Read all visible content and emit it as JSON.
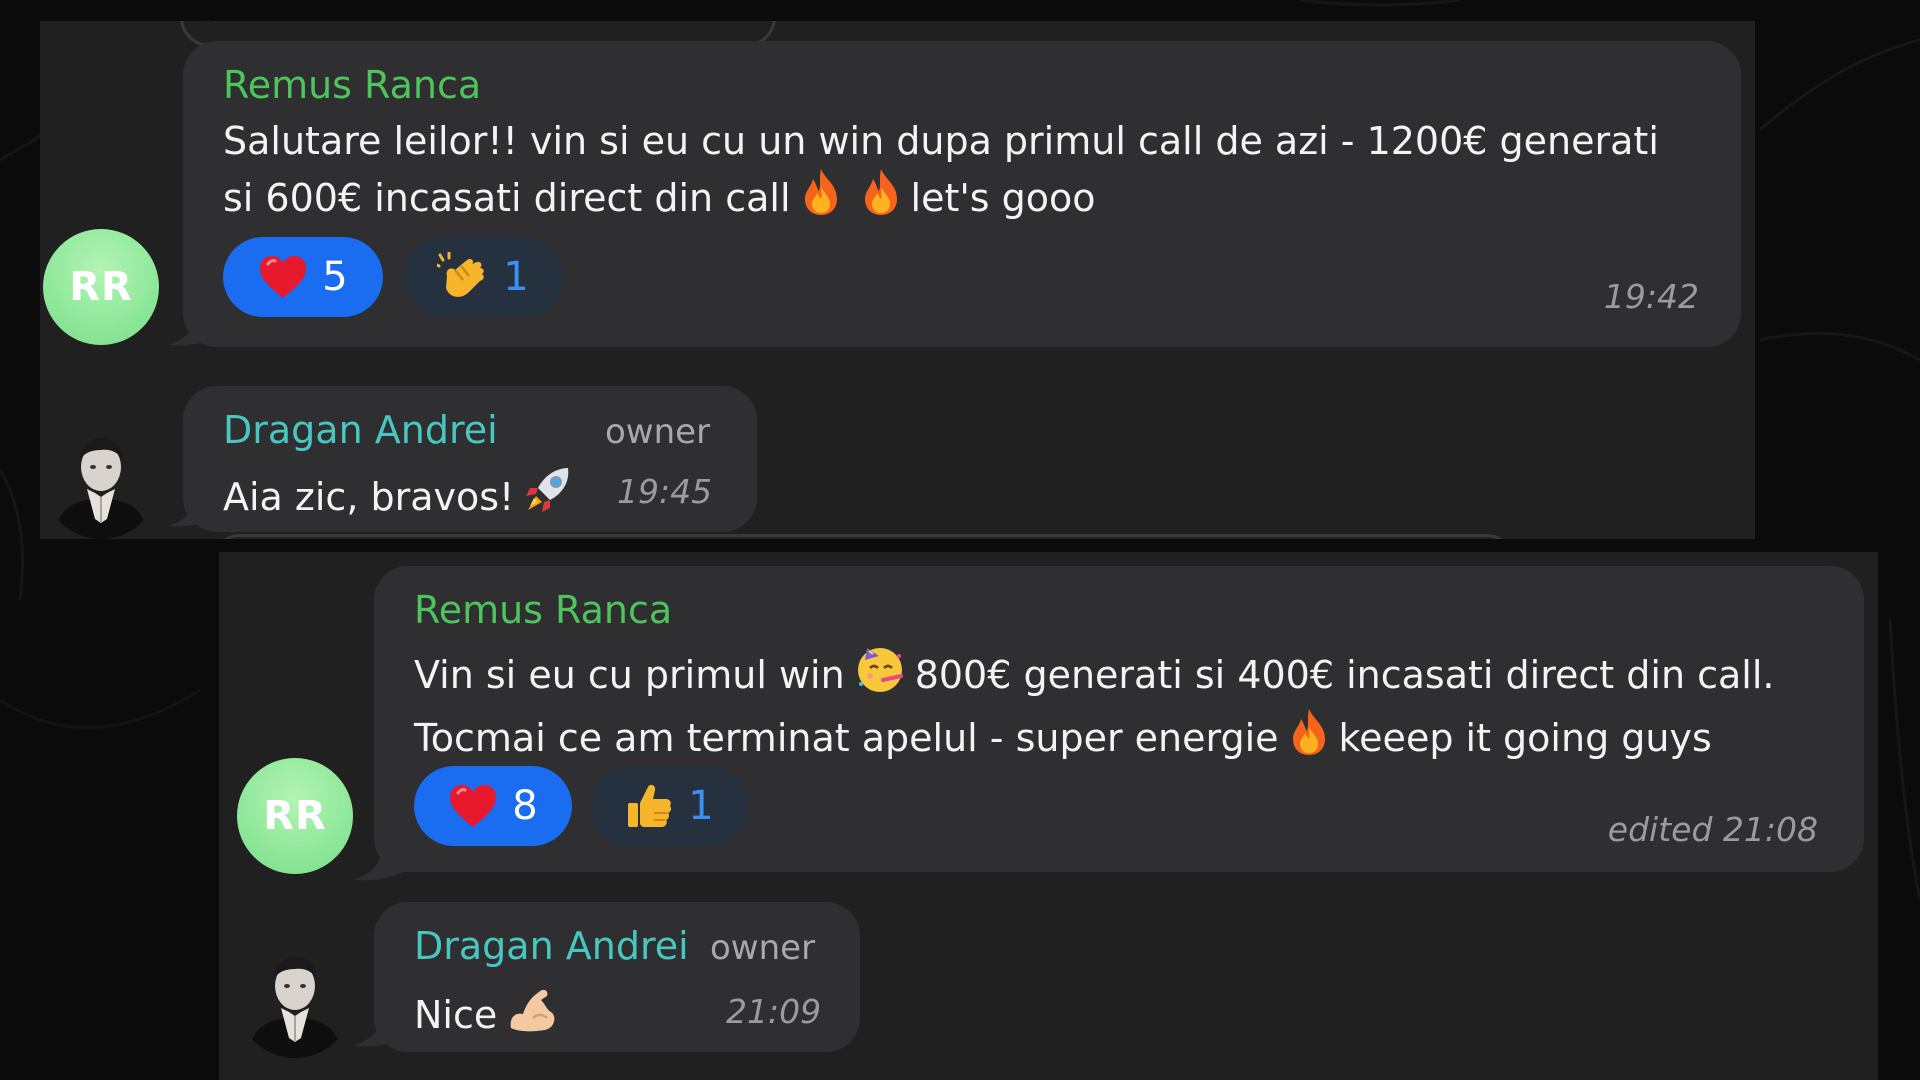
{
  "screenshot_1": {
    "messages": [
      {
        "sender": "Remus Ranca",
        "avatar_initials": "RR",
        "text_line1_a": "Salutare leilor!! vin si eu cu un win dupa primul call de azi - 1200€ generati",
        "text_line2_a": "si 600€ incasati direct din call",
        "text_line2_b": "let's gooo",
        "emojis": [
          "fire-emoji",
          "fire-emoji"
        ],
        "reactions": [
          {
            "icon": "heart-emoji",
            "count": "5"
          },
          {
            "icon": "clapping-hands-emoji",
            "count": "1"
          }
        ],
        "time": "19:42"
      },
      {
        "sender": "Dragan Andrei",
        "role": "owner",
        "text": "Aia zic, bravos!",
        "emoji": "rocket-emoji",
        "time": "19:45"
      }
    ]
  },
  "screenshot_2": {
    "messages": [
      {
        "sender": "Remus Ranca",
        "avatar_initials": "RR",
        "text_line1_a": "Vin si eu cu primul win",
        "text_line1_b": "800€ generati si 400€ incasati direct din call.",
        "text_line2_a": "Tocmai ce am terminat apelul - super energie",
        "text_line2_b": "keeep it going guys",
        "emojis": [
          "partying-face-emoji",
          "fire-emoji"
        ],
        "reactions": [
          {
            "icon": "heart-emoji",
            "count": "8"
          },
          {
            "icon": "thumbs-up-emoji",
            "count": "1"
          }
        ],
        "time": "edited 21:08"
      },
      {
        "sender": "Dragan Andrei",
        "role": "owner",
        "text": "Nice",
        "emoji": "flexed-biceps-emoji",
        "time": "21:09"
      }
    ]
  },
  "colors": {
    "page_background": "#0b0b0b",
    "panel_background": "#202021",
    "bubble_background": "#2f2f31",
    "sender_green": "#4ec45c",
    "sender_teal": "#48c7c0",
    "reaction_active": "#1a6cf0",
    "reaction_idle": "#263140",
    "reaction_idle_text": "#3d90f3",
    "timestamp": "#9a9aa0",
    "avatar_green": "#8ee89a"
  }
}
